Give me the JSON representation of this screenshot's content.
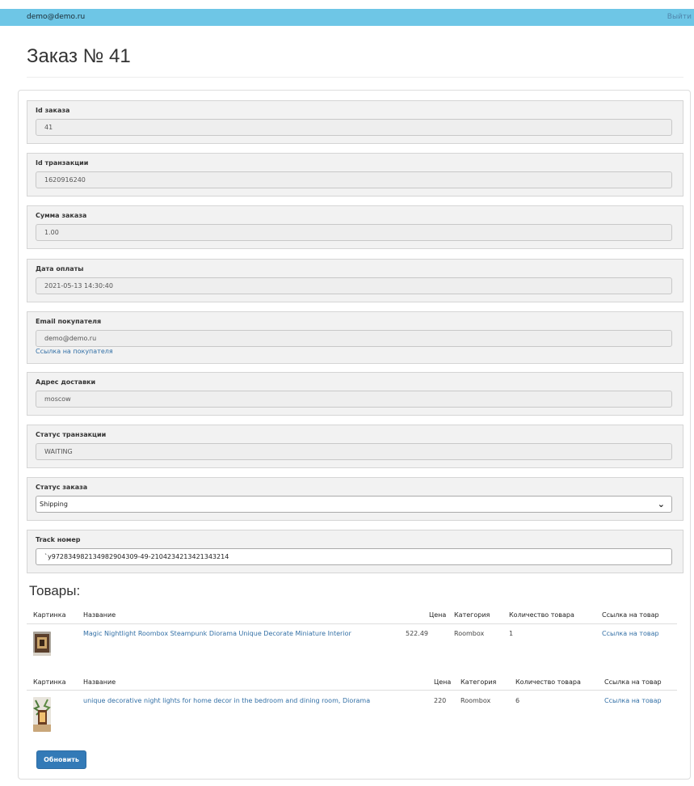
{
  "header": {
    "user_email": "demo@demo.ru",
    "logout_label": "Выйти"
  },
  "page": {
    "title": "Заказ № 41"
  },
  "order": {
    "id_label": "Id заказа",
    "id_value": "41",
    "txn_label": "Id транзакции",
    "txn_value": "1620916240",
    "sum_label": "Сумма заказа",
    "sum_value": "1.00",
    "date_label": "Дата оплаты",
    "date_value": "2021-05-13 14:30:40",
    "email_label": "Email покупателя",
    "email_value": "demo@demo.ru",
    "buyer_link": "Ссылка на покупателя",
    "address_label": "Адрес доставки",
    "address_value": "moscow",
    "txn_status_label": "Статус транзакции",
    "txn_status_value": "WAITING",
    "order_status_label": "Статус заказа",
    "order_status_value": "Shipping",
    "track_label": "Track номер",
    "track_value": "`y97283498213498290430​9-49-2104234213421343214"
  },
  "goods": {
    "title": "Товары:",
    "headers": {
      "image": "Картинка",
      "name": "Название",
      "price": "Цена",
      "category": "Категория",
      "qty": "Количество товара",
      "link": "Ссылка на товар"
    },
    "items": [
      {
        "name": "Magic Nightlight Roombox Steampunk Diorama Unique Decorate Miniature Interior",
        "price": "522.49",
        "category": "Roombox",
        "qty": "1",
        "link": "Ссылка на товар"
      },
      {
        "name": "unique decorative night lights for home decor in the bedroom and dining room, Diorama",
        "price": "220",
        "category": "Roombox",
        "qty": "6",
        "link": "Ссылка на товар"
      }
    ]
  },
  "actions": {
    "update_label": "Обновить"
  },
  "colors": {
    "topbar": "#6ec6e6",
    "link": "#3370a6",
    "button": "#337ab7"
  }
}
